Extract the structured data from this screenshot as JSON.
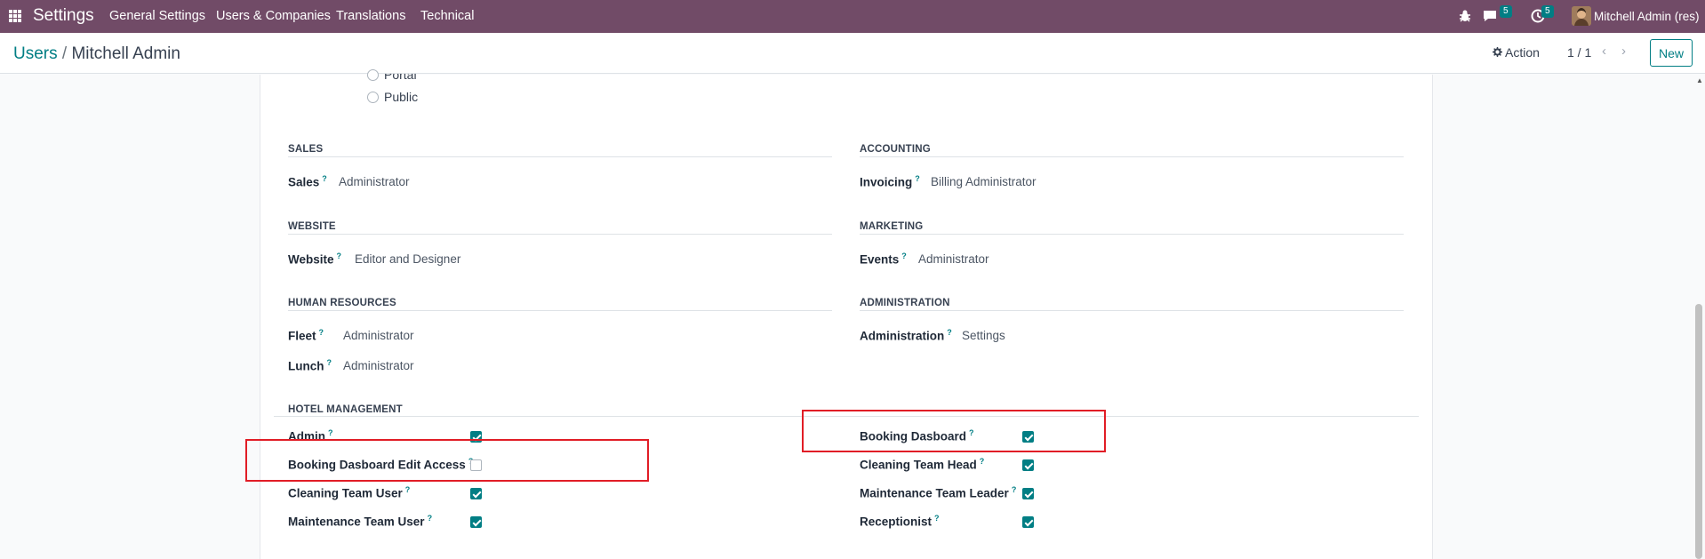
{
  "navbar": {
    "app_name": "Settings",
    "menu": [
      "General Settings",
      "Users & Companies",
      "Translations",
      "Technical"
    ],
    "chat_badge": "5",
    "activity_badge": "5",
    "user_name": "Mitchell Admin (res)"
  },
  "breadcrumb": {
    "parent": "Users",
    "separator": "/",
    "current": "Mitchell Admin"
  },
  "control": {
    "action_label": "Action",
    "pager": "1 / 1",
    "new_label": "New"
  },
  "user_type_options": [
    "Portal",
    "Public"
  ],
  "sections": {
    "sales": {
      "title": "SALES",
      "field": "Sales",
      "value": "Administrator"
    },
    "accounting": {
      "title": "ACCOUNTING",
      "field": "Invoicing",
      "value": "Billing Administrator"
    },
    "website": {
      "title": "WEBSITE",
      "field": "Website",
      "value": "Editor and Designer"
    },
    "marketing": {
      "title": "MARKETING",
      "field": "Events",
      "value": "Administrator"
    },
    "hr": {
      "title": "HUMAN RESOURCES",
      "fields": [
        {
          "label": "Fleet",
          "value": "Administrator"
        },
        {
          "label": "Lunch",
          "value": "Administrator"
        }
      ]
    },
    "administration": {
      "title": "ADMINISTRATION",
      "field": "Administration",
      "value": "Settings"
    },
    "hotel": {
      "title": "HOTEL MANAGEMENT",
      "left": [
        {
          "label": "Admin",
          "checked": true
        },
        {
          "label": "Booking Dasboard Edit Access",
          "checked": false
        },
        {
          "label": "Cleaning Team User",
          "checked": true
        },
        {
          "label": "Maintenance Team User",
          "checked": true
        }
      ],
      "right": [
        {
          "label": "Booking Dasboard",
          "checked": true
        },
        {
          "label": "Cleaning Team Head",
          "checked": true
        },
        {
          "label": "Maintenance Team Leader",
          "checked": true
        },
        {
          "label": "Receptionist",
          "checked": true
        }
      ]
    }
  },
  "help_marker": "?",
  "colors": {
    "navbar": "#714b67",
    "accent": "#017e84",
    "highlight": "#e11d26"
  }
}
